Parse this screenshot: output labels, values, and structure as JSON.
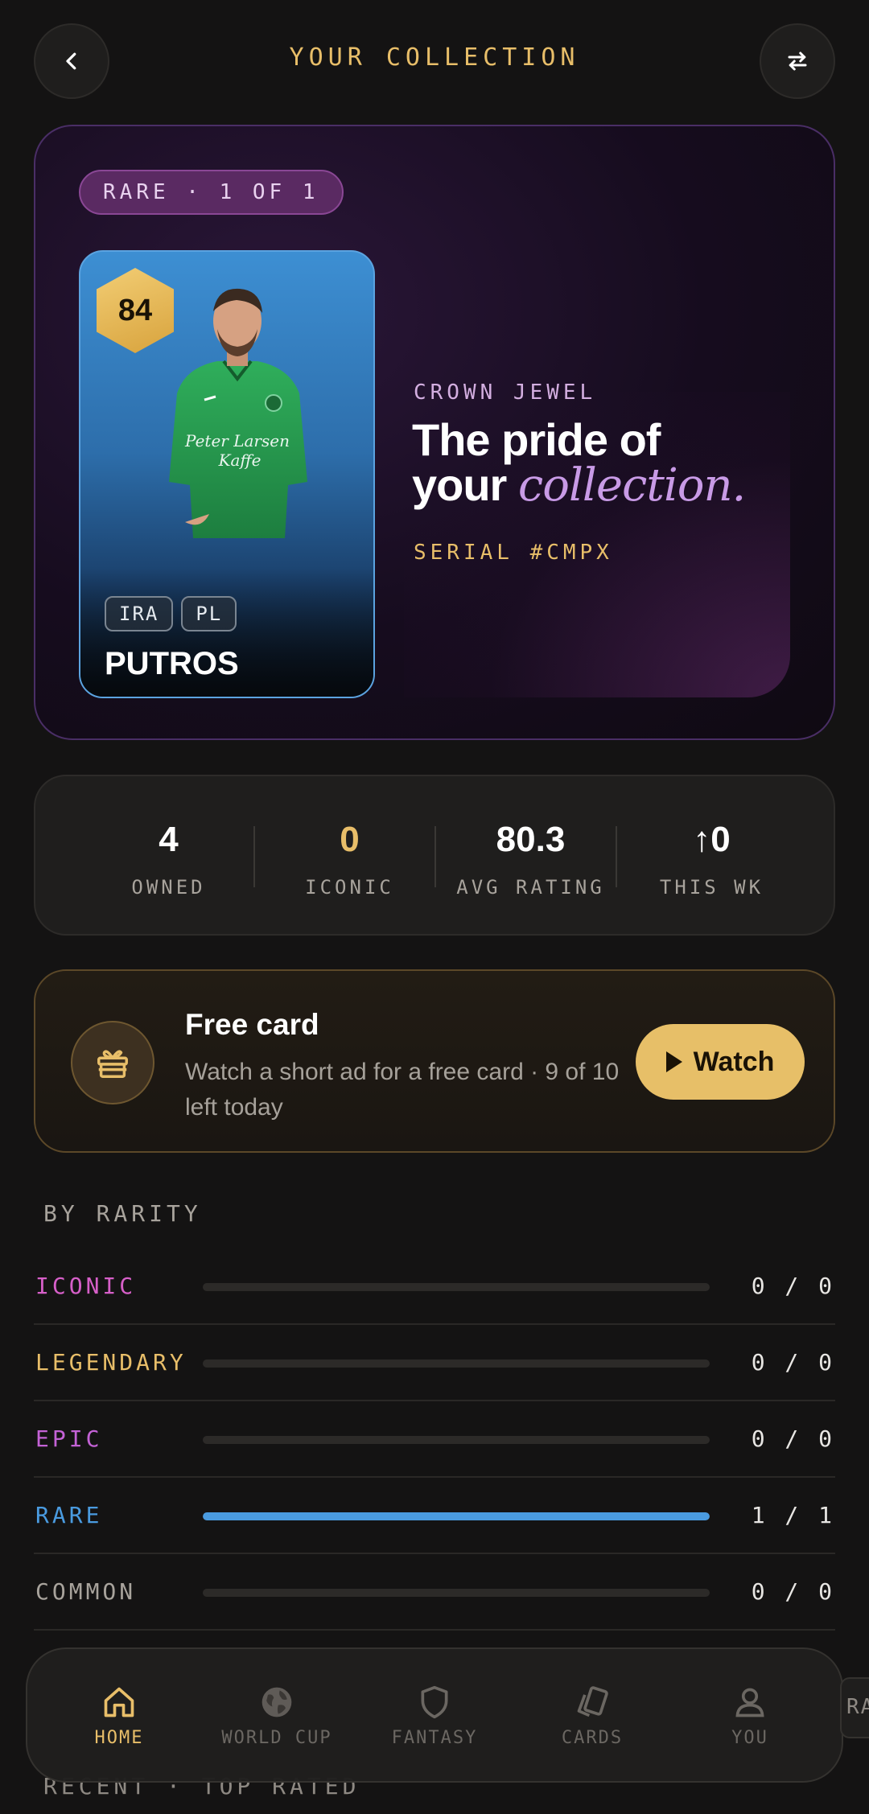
{
  "header": {
    "title": "YOUR COLLECTION"
  },
  "hero": {
    "rarity_pill": "RARE · 1 OF 1",
    "card": {
      "rating": "84",
      "tags": [
        "IRA",
        "PL"
      ],
      "player_name": "PUTROS"
    },
    "crown_label": "CROWN JEWEL",
    "headline_line1": "The pride of",
    "headline_line2_plain": "your",
    "headline_line2_accent": "collection.",
    "serial": "SERIAL #CMPX"
  },
  "stats": [
    {
      "value": "4",
      "label": "OWNED",
      "color": "#ffffff"
    },
    {
      "value": "0",
      "label": "ICONIC",
      "color": "#e8be69"
    },
    {
      "value": "80.3",
      "label": "AVG RATING",
      "color": "#ffffff"
    },
    {
      "value": "↑0",
      "label": "THIS WK",
      "color": "#ffffff"
    }
  ],
  "free_card": {
    "title": "Free card",
    "description": "Watch a short ad for a free card · 9 of 10 left today",
    "button": "Watch"
  },
  "by_rarity": {
    "label": "BY RARITY",
    "rows": [
      {
        "name": "ICONIC",
        "count": "0 / 0",
        "fraction": 0,
        "color": "#d65fc8"
      },
      {
        "name": "LEGENDARY",
        "count": "0 / 0",
        "fraction": 0,
        "color": "#e8be69"
      },
      {
        "name": "EPIC",
        "count": "0 / 0",
        "fraction": 0,
        "color": "#c462d6"
      },
      {
        "name": "RARE",
        "count": "1 / 1",
        "fraction": 1,
        "color": "#4a9be0"
      },
      {
        "name": "COMMON",
        "count": "0 / 0",
        "fraction": 0,
        "color": "#a8a39c"
      }
    ]
  },
  "recent_label": "RECENT · TOP RATED",
  "nav": {
    "items": [
      {
        "label": "HOME",
        "icon": "home-icon",
        "active": true
      },
      {
        "label": "WORLD CUP",
        "icon": "globe-icon",
        "active": false
      },
      {
        "label": "FANTASY",
        "icon": "shield-icon",
        "active": false
      },
      {
        "label": "CARDS",
        "icon": "cards-icon",
        "active": false
      },
      {
        "label": "YOU",
        "icon": "user-icon",
        "active": false
      }
    ]
  },
  "edge_chip": "RA",
  "colors": {
    "gold": "#e8be69",
    "background": "#141313",
    "rare_blue": "#4a9be0"
  }
}
